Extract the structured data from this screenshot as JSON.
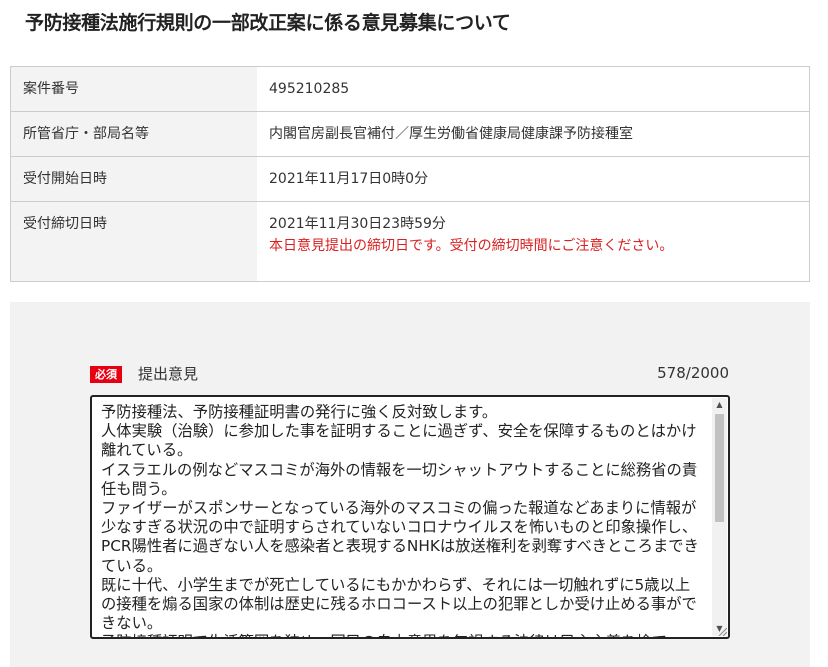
{
  "page": {
    "title": "予防接種法施行規則の一部改正案に係る意見募集について"
  },
  "info_table": {
    "rows": [
      {
        "label": "案件番号",
        "value": "495210285"
      },
      {
        "label": "所管省庁・部局名等",
        "value": "内閣官房副長官補付／厚生労働省健康局健康課予防接種室"
      },
      {
        "label": "受付開始日時",
        "value": "2021年11月17日0時0分"
      },
      {
        "label": "受付締切日時",
        "value": "2021年11月30日23時59分",
        "warning": "本日意見提出の締切日です。受付の締切時間にご注意ください。"
      }
    ]
  },
  "form": {
    "required_badge": "必須",
    "field_label": "提出意見",
    "char_count": "578/2000",
    "opinion_text": "予防接種法、予防接種証明書の発行に強く反対致します。\n人体実験（治験）に参加した事を証明することに過ぎず、安全を保障するものとはかけ離れている。\nイスラエルの例などマスコミが海外の情報を一切シャットアウトすることに総務省の責任も問う。\nファイザーがスポンサーとなっている海外のマスコミの偏った報道などあまりに情報が少なすぎる状況の中で証明すらされていないコロナウイルスを怖いものと印象操作し、PCR陽性者に過ぎない人を感染者と表現するNHKは放送権利を剥奪すべきところまできている。\n既に十代、小学生までが死亡しているにもかかわらず、それには一切触れずに5歳以上の接種を煽る国家の体制は歴史に残るホロコースト以上の犯罪としか受け止める事ができない。\n予防接種証明で生活範囲を狭め、国民の自由意思を無視する法律は民主主義を捨て"
  },
  "colors": {
    "warning": "#d92121",
    "badge": "#e60012",
    "label_bg": "#f3f3f3",
    "panel_bg": "#f2f2f2"
  },
  "icons": {
    "scroll_up": "triangle-up-icon",
    "scroll_down": "triangle-down-icon",
    "resize": "resize-grip-icon"
  }
}
